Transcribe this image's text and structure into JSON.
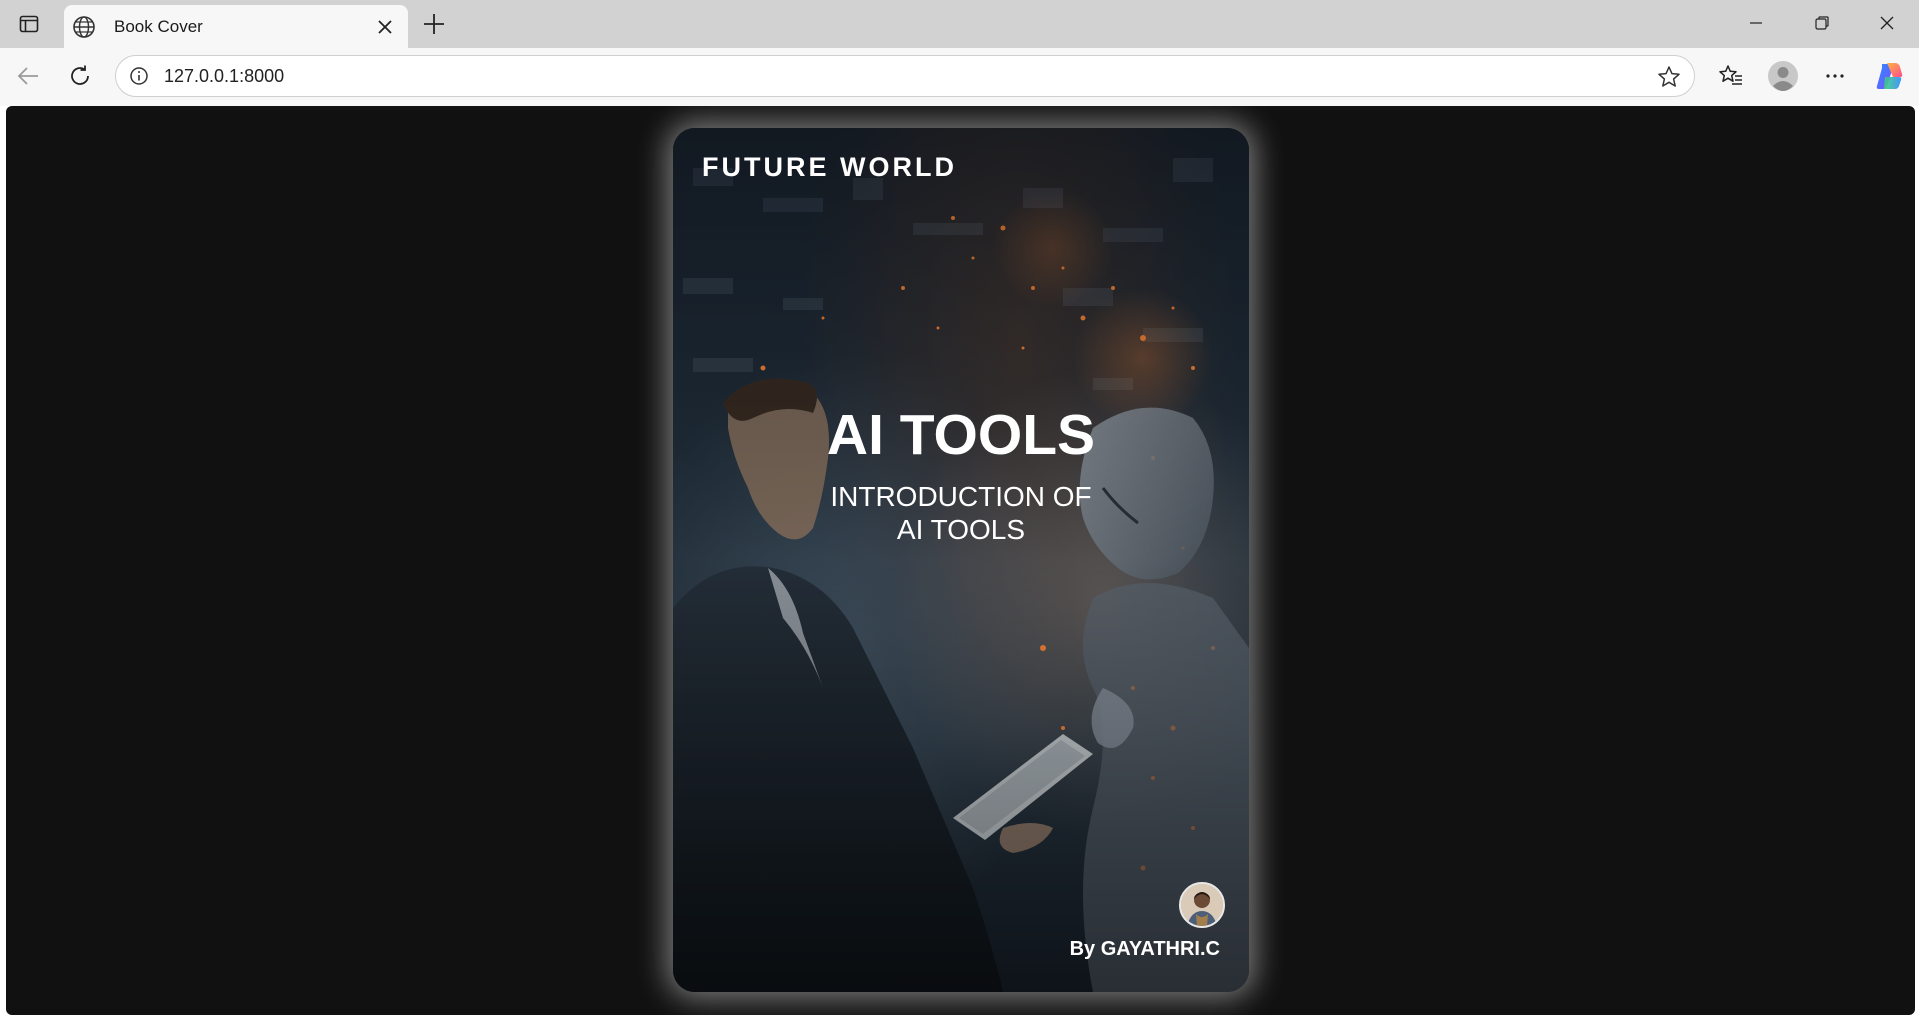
{
  "browser": {
    "tab": {
      "title": "Book Cover"
    },
    "address_bar": {
      "url": "127.0.0.1:8000"
    }
  },
  "book_cover": {
    "brand": "FUTURE WORLD",
    "title": "AI TOOLS",
    "subtitle_line1": "INTRODUCTION OF",
    "subtitle_line2": "AI TOOLS",
    "author": "By GAYATHRI.C"
  },
  "colors": {
    "page_background": "#111111",
    "cover_text": "#ffffff",
    "tab_strip": "#d2d2d2",
    "toolbar": "#f7f7f7"
  }
}
